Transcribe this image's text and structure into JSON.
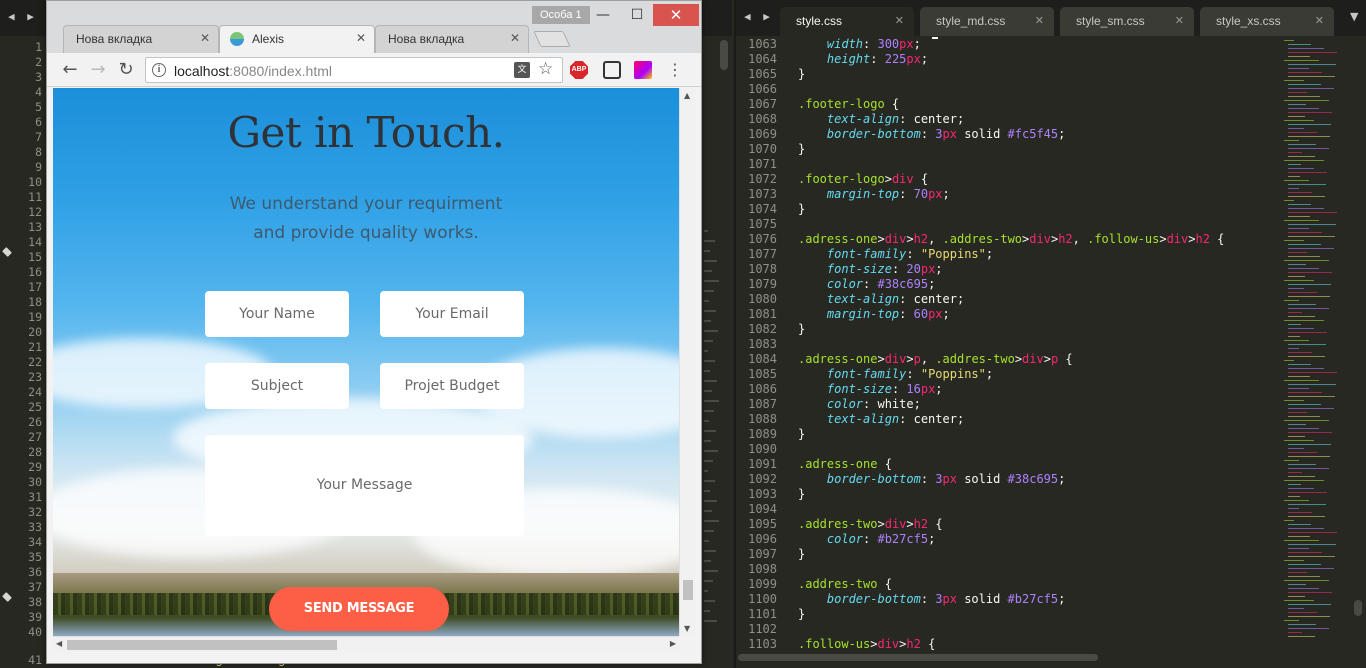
{
  "left_editor": {
    "line_numbers": [
      "1",
      "2",
      "3",
      "4",
      "5",
      "6",
      "7",
      "8",
      "9",
      "10",
      "11",
      "12",
      "13",
      "14",
      "15",
      "16",
      "17",
      "18",
      "19",
      "20",
      "21",
      "22",
      "23",
      "24",
      "25",
      "26",
      "27",
      "28",
      "29",
      "30",
      "31",
      "32",
      "33",
      "34",
      "35",
      "36",
      "37",
      "38",
      "39",
      "40",
      "41"
    ],
    "bottom_code": {
      "open": "<",
      "tag": "div",
      "attr": " class=",
      "value": "\"backgroundImg\"",
      "close": ">"
    }
  },
  "browser": {
    "profile_badge": "Особа 1",
    "minimize_glyph": "—",
    "maximize_glyph": "☐",
    "close_glyph": "✕",
    "tabs": [
      {
        "label": "Нова вкладка",
        "active": false
      },
      {
        "label": "Alexis",
        "active": true
      },
      {
        "label": "Нова вкладка",
        "active": false
      }
    ],
    "tab_close_glyph": "✕",
    "url_host": "localhost",
    "url_rest": ":8080/index.html",
    "back_glyph": "←",
    "forward_glyph": "→",
    "reload_glyph": "↻",
    "info_glyph": "i",
    "translate_glyph": "文",
    "star_glyph": "☆",
    "abp_label": "ABP",
    "menu_glyph": "⋮"
  },
  "page": {
    "title": "Get in Touch.",
    "subtitle_line1": "We understand your requirment",
    "subtitle_line2": "and provide quality works.",
    "fields": {
      "name": "Your Name",
      "email": "Your Email",
      "subject": "Subject",
      "budget": "Projet Budget",
      "message": "Your Message"
    },
    "send_button": "SEND MESSAGE",
    "accent_color": "#fc5f45"
  },
  "right_editor": {
    "tabs": [
      {
        "label": "style.css",
        "active": true
      },
      {
        "label": "style_md.css",
        "active": false
      },
      {
        "label": "style_sm.css",
        "active": false
      },
      {
        "label": "style_xs.css",
        "active": false
      }
    ],
    "tab_close_glyph": "✕",
    "lines": [
      {
        "n": "1063",
        "t": [
          [
            "    ",
            ""
          ],
          [
            "width",
            "prop"
          ],
          [
            ": ",
            ""
          ],
          [
            "300",
            "num"
          ],
          [
            "px",
            "unit"
          ],
          [
            ";",
            ""
          ]
        ]
      },
      {
        "n": "1064",
        "t": [
          [
            "    ",
            ""
          ],
          [
            "height",
            "prop"
          ],
          [
            ": ",
            ""
          ],
          [
            "225",
            "num"
          ],
          [
            "px",
            "unit"
          ],
          [
            ";",
            ""
          ]
        ]
      },
      {
        "n": "1065",
        "t": [
          [
            "}",
            ""
          ]
        ]
      },
      {
        "n": "1066",
        "t": []
      },
      {
        "n": "1067",
        "t": [
          [
            ".footer-logo",
            "sel"
          ],
          [
            " {",
            ""
          ]
        ]
      },
      {
        "n": "1068",
        "t": [
          [
            "    ",
            ""
          ],
          [
            "text-align",
            "prop"
          ],
          [
            ": center;",
            ""
          ]
        ]
      },
      {
        "n": "1069",
        "t": [
          [
            "    ",
            ""
          ],
          [
            "border-bottom",
            "prop"
          ],
          [
            ": ",
            ""
          ],
          [
            "3",
            "num"
          ],
          [
            "px",
            "unit"
          ],
          [
            " solid ",
            ""
          ],
          [
            "#fc5f45",
            "num"
          ],
          [
            ";",
            ""
          ]
        ]
      },
      {
        "n": "1070",
        "t": [
          [
            "}",
            ""
          ]
        ]
      },
      {
        "n": "1071",
        "t": []
      },
      {
        "n": "1072",
        "t": [
          [
            ".footer-logo",
            "sel"
          ],
          [
            ">",
            ""
          ],
          [
            "div",
            "tag"
          ],
          [
            " {",
            ""
          ]
        ]
      },
      {
        "n": "1073",
        "t": [
          [
            "    ",
            ""
          ],
          [
            "margin-top",
            "prop"
          ],
          [
            ": ",
            ""
          ],
          [
            "70",
            "num"
          ],
          [
            "px",
            "unit"
          ],
          [
            ";",
            ""
          ]
        ]
      },
      {
        "n": "1074",
        "t": [
          [
            "}",
            ""
          ]
        ]
      },
      {
        "n": "1075",
        "t": []
      },
      {
        "n": "1076",
        "t": [
          [
            ".adress-one",
            "sel"
          ],
          [
            ">",
            ""
          ],
          [
            "div",
            "tag"
          ],
          [
            ">",
            ""
          ],
          [
            "h2",
            "tag"
          ],
          [
            ", ",
            ""
          ],
          [
            ".addres-two",
            "sel"
          ],
          [
            ">",
            ""
          ],
          [
            "div",
            "tag"
          ],
          [
            ">",
            ""
          ],
          [
            "h2",
            "tag"
          ],
          [
            ", ",
            ""
          ],
          [
            ".follow-us",
            "sel"
          ],
          [
            ">",
            ""
          ],
          [
            "div",
            "tag"
          ],
          [
            ">",
            ""
          ],
          [
            "h2",
            "tag"
          ],
          [
            " {",
            ""
          ]
        ]
      },
      {
        "n": "1077",
        "t": [
          [
            "    ",
            ""
          ],
          [
            "font-family",
            "prop"
          ],
          [
            ": ",
            ""
          ],
          [
            "\"Poppins\"",
            "str"
          ],
          [
            ";",
            ""
          ]
        ]
      },
      {
        "n": "1078",
        "t": [
          [
            "    ",
            ""
          ],
          [
            "font-size",
            "prop"
          ],
          [
            ": ",
            ""
          ],
          [
            "20",
            "num"
          ],
          [
            "px",
            "unit"
          ],
          [
            ";",
            ""
          ]
        ]
      },
      {
        "n": "1079",
        "t": [
          [
            "    ",
            ""
          ],
          [
            "color",
            "prop"
          ],
          [
            ": ",
            ""
          ],
          [
            "#38c695",
            "num"
          ],
          [
            ";",
            ""
          ]
        ]
      },
      {
        "n": "1080",
        "t": [
          [
            "    ",
            ""
          ],
          [
            "text-align",
            "prop"
          ],
          [
            ": center;",
            ""
          ]
        ]
      },
      {
        "n": "1081",
        "t": [
          [
            "    ",
            ""
          ],
          [
            "margin-top",
            "prop"
          ],
          [
            ": ",
            ""
          ],
          [
            "60",
            "num"
          ],
          [
            "px",
            "unit"
          ],
          [
            ";",
            ""
          ]
        ]
      },
      {
        "n": "1082",
        "t": [
          [
            "}",
            ""
          ]
        ]
      },
      {
        "n": "1083",
        "t": []
      },
      {
        "n": "1084",
        "t": [
          [
            ".adress-one",
            "sel"
          ],
          [
            ">",
            ""
          ],
          [
            "div",
            "tag"
          ],
          [
            ">",
            ""
          ],
          [
            "p",
            "tag"
          ],
          [
            ", ",
            ""
          ],
          [
            ".addres-two",
            "sel"
          ],
          [
            ">",
            ""
          ],
          [
            "div",
            "tag"
          ],
          [
            ">",
            ""
          ],
          [
            "p",
            "tag"
          ],
          [
            " {",
            ""
          ]
        ]
      },
      {
        "n": "1085",
        "t": [
          [
            "    ",
            ""
          ],
          [
            "font-family",
            "prop"
          ],
          [
            ": ",
            ""
          ],
          [
            "\"Poppins\"",
            "str"
          ],
          [
            ";",
            ""
          ]
        ]
      },
      {
        "n": "1086",
        "t": [
          [
            "    ",
            ""
          ],
          [
            "font-size",
            "prop"
          ],
          [
            ": ",
            ""
          ],
          [
            "16",
            "num"
          ],
          [
            "px",
            "unit"
          ],
          [
            ";",
            ""
          ]
        ]
      },
      {
        "n": "1087",
        "t": [
          [
            "    ",
            ""
          ],
          [
            "color",
            "prop"
          ],
          [
            ": white;",
            ""
          ]
        ]
      },
      {
        "n": "1088",
        "t": [
          [
            "    ",
            ""
          ],
          [
            "text-align",
            "prop"
          ],
          [
            ": center;",
            ""
          ]
        ]
      },
      {
        "n": "1089",
        "t": [
          [
            "}",
            ""
          ]
        ]
      },
      {
        "n": "1090",
        "t": []
      },
      {
        "n": "1091",
        "t": [
          [
            ".adress-one",
            "sel"
          ],
          [
            " {",
            ""
          ]
        ]
      },
      {
        "n": "1092",
        "t": [
          [
            "    ",
            ""
          ],
          [
            "border-bottom",
            "prop"
          ],
          [
            ": ",
            ""
          ],
          [
            "3",
            "num"
          ],
          [
            "px",
            "unit"
          ],
          [
            " solid ",
            ""
          ],
          [
            "#38c695",
            "num"
          ],
          [
            ";",
            ""
          ]
        ]
      },
      {
        "n": "1093",
        "t": [
          [
            "}",
            ""
          ]
        ]
      },
      {
        "n": "1094",
        "t": []
      },
      {
        "n": "1095",
        "t": [
          [
            ".addres-two",
            "sel"
          ],
          [
            ">",
            ""
          ],
          [
            "div",
            "tag"
          ],
          [
            ">",
            ""
          ],
          [
            "h2",
            "tag"
          ],
          [
            " {",
            ""
          ]
        ]
      },
      {
        "n": "1096",
        "t": [
          [
            "    ",
            ""
          ],
          [
            "color",
            "prop"
          ],
          [
            ": ",
            ""
          ],
          [
            "#b27cf5",
            "num"
          ],
          [
            ";",
            ""
          ]
        ]
      },
      {
        "n": "1097",
        "t": [
          [
            "}",
            ""
          ]
        ]
      },
      {
        "n": "1098",
        "t": []
      },
      {
        "n": "1099",
        "t": [
          [
            ".addres-two",
            "sel"
          ],
          [
            " {",
            ""
          ]
        ]
      },
      {
        "n": "1100",
        "t": [
          [
            "    ",
            ""
          ],
          [
            "border-bottom",
            "prop"
          ],
          [
            ": ",
            ""
          ],
          [
            "3",
            "num"
          ],
          [
            "px",
            "unit"
          ],
          [
            " solid ",
            ""
          ],
          [
            "#b27cf5",
            "num"
          ],
          [
            ";",
            ""
          ]
        ]
      },
      {
        "n": "1101",
        "t": [
          [
            "}",
            ""
          ]
        ]
      },
      {
        "n": "1102",
        "t": []
      },
      {
        "n": "1103",
        "t": [
          [
            ".follow-us",
            "sel"
          ],
          [
            ">",
            ""
          ],
          [
            "div",
            "tag"
          ],
          [
            ">",
            ""
          ],
          [
            "h2",
            "tag"
          ],
          [
            " {",
            ""
          ]
        ]
      }
    ]
  }
}
